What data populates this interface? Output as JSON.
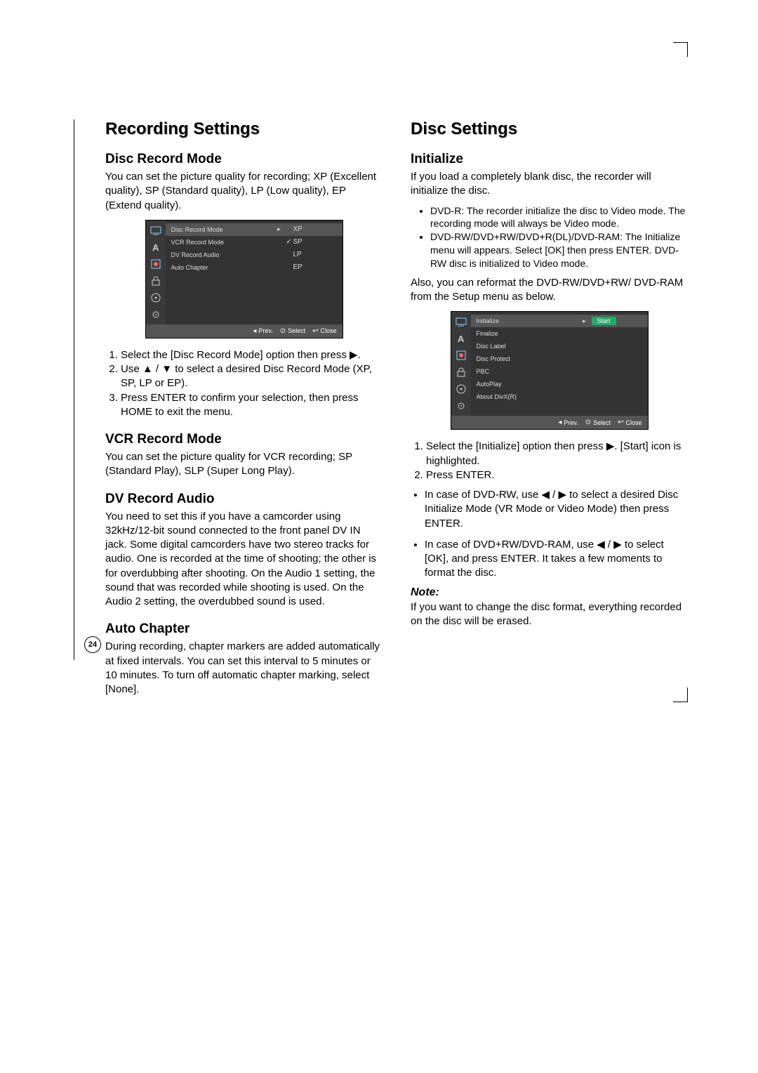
{
  "left": {
    "h1": "Recording Settings",
    "s1": {
      "h2": "Disc Record Mode",
      "p1": "You can set the picture quality for recording; XP (Excellent quality), SP (Standard quality), LP (Low quality), EP (Extend quality).",
      "steps": {
        "1": "Select the [Disc Record Mode] option then press ▶.",
        "2": "Use ▲ / ▼ to select a desired Disc Record Mode (XP, SP, LP or EP).",
        "3": "Press ENTER to confirm your selection, then press HOME to exit the menu."
      }
    },
    "s2": {
      "h2": "VCR Record Mode",
      "p": "You can set the picture quality for VCR recording; SP (Standard Play), SLP (Super Long Play)."
    },
    "s3": {
      "h2": "DV Record Audio",
      "p": "You need to set this if you have a camcorder using 32kHz/12-bit sound connected to the front panel DV IN jack. Some digital camcorders have two stereo tracks for audio. One is recorded at the time of shooting; the other is for overdubbing after shooting. On the Audio 1 setting, the sound that was recorded while shooting is used. On the Audio 2 setting, the overdubbed sound is used."
    },
    "s4": {
      "h2": "Auto Chapter",
      "p": "During recording, chapter markers are added automatically at fixed intervals. You can set this interval to 5 minutes or 10 minutes. To turn off automatic chapter marking, select [None]."
    }
  },
  "right": {
    "h1": "Disc Settings",
    "s1": {
      "h2": "Initialize",
      "p1": "If you load a completely blank disc, the recorder will initialize the disc.",
      "bul": {
        "a": "DVD-R: The recorder initialize the disc to Video mode. The recording mode will always be Video mode.",
        "b": "DVD-RW/DVD+RW/DVD+R(DL)/DVD-RAM: The Initialize menu will appears. Select [OK] then press ENTER. DVD-RW disc is initialized to Video mode."
      },
      "p2": "Also, you can reformat the DVD-RW/DVD+RW/ DVD-RAM from the Setup menu as below.",
      "steps": {
        "1": "Select the [Initialize] option then press ▶. [Start] icon is highlighted.",
        "2": "Press ENTER."
      },
      "bul2": {
        "a": "In case of DVD-RW, use ◀ / ▶ to select a desired Disc Initialize Mode (VR Mode or Video Mode) then press ENTER.",
        "b": "In case of DVD+RW/DVD-RAM, use ◀ / ▶ to select [OK], and press ENTER. It takes a few moments to format the disc."
      },
      "noteLabel": "Note:",
      "noteText": "If you want to change the disc format, everything recorded on the disc will be erased."
    }
  },
  "osd1": {
    "items": {
      "a": "Disc Record Mode",
      "b": "VCR Record Mode",
      "c": "DV Record Audio",
      "d": "Auto Chapter"
    },
    "vals": {
      "xp": "XP",
      "sp": "SP",
      "lp": "LP",
      "ep": "EP"
    },
    "footer": {
      "prev": "Prev.",
      "select": "Select",
      "close": "Close"
    }
  },
  "osd2": {
    "items": {
      "a": "Initialize",
      "b": "Finalize",
      "c": "Disc Label",
      "d": "Disc Protect",
      "e": "PBC",
      "f": "AutoPlay",
      "g": "About DivX(R)"
    },
    "startBtn": "Start",
    "footer": {
      "prev": "Prev.",
      "select": "Select",
      "close": "Close"
    }
  },
  "pageNumber": "24"
}
